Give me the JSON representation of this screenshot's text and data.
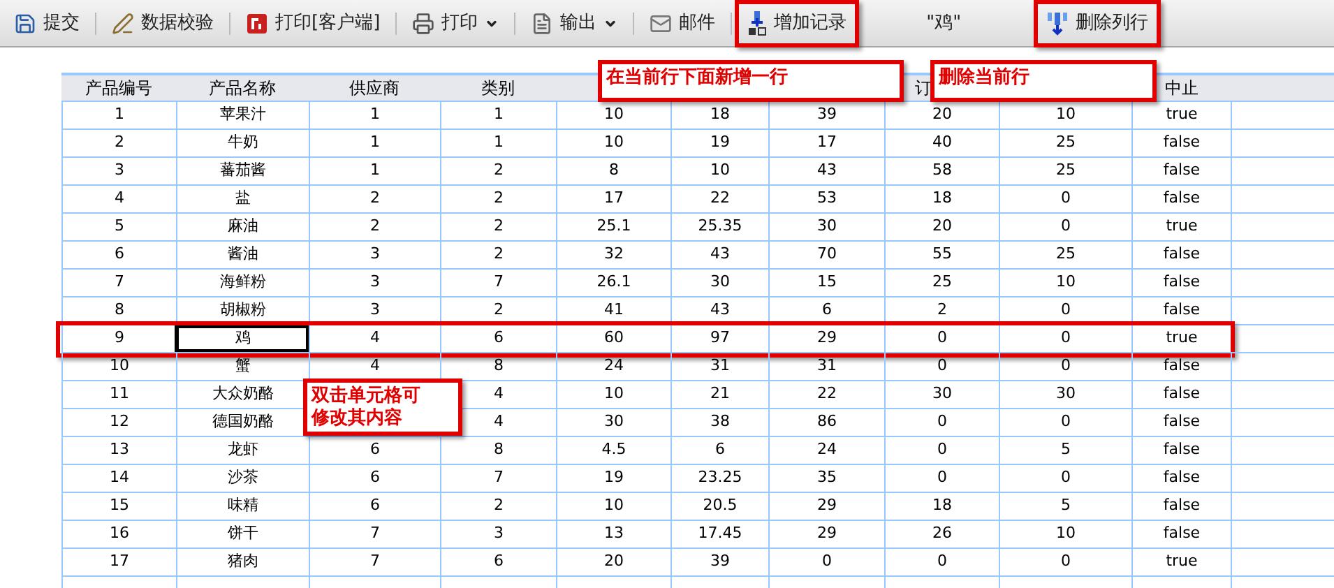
{
  "toolbar": [
    {
      "kind": "button",
      "label": "提交",
      "highlighted": false
    },
    {
      "kind": "button",
      "label": "数据校验",
      "highlighted": false
    },
    {
      "kind": "button",
      "label": "打印[客户端]",
      "highlighted": false
    },
    {
      "kind": "dropdown",
      "label": "打印",
      "highlighted": false
    },
    {
      "kind": "dropdown",
      "label": "输出",
      "highlighted": false
    },
    {
      "kind": "button",
      "label": "邮件",
      "highlighted": false
    },
    {
      "kind": "button",
      "label": "增加记录",
      "highlighted": true
    },
    {
      "kind": "label",
      "label": "\"鸡\""
    },
    {
      "kind": "button",
      "label": "删除列行",
      "highlighted": true
    }
  ],
  "table": {
    "columns": [
      "产品编号",
      "产品名称",
      "供应商",
      "类别",
      "",
      "",
      "",
      "订",
      "",
      "中止"
    ],
    "rows": [
      {
        "cells": [
          "1",
          "苹果汁",
          "1",
          "1",
          "10",
          "18",
          "39",
          "20",
          "10",
          "true"
        ],
        "selected": false,
        "highlighted": false
      },
      {
        "cells": [
          "2",
          "牛奶",
          "1",
          "1",
          "10",
          "19",
          "17",
          "40",
          "25",
          "false"
        ],
        "selected": false,
        "highlighted": false
      },
      {
        "cells": [
          "3",
          "蕃茄酱",
          "1",
          "2",
          "8",
          "10",
          "43",
          "58",
          "25",
          "false"
        ],
        "selected": false,
        "highlighted": false
      },
      {
        "cells": [
          "4",
          "盐",
          "2",
          "2",
          "17",
          "22",
          "53",
          "18",
          "0",
          "false"
        ],
        "selected": false,
        "highlighted": false
      },
      {
        "cells": [
          "5",
          "麻油",
          "2",
          "2",
          "25.1",
          "25.35",
          "30",
          "20",
          "0",
          "true"
        ],
        "selected": false,
        "highlighted": false
      },
      {
        "cells": [
          "6",
          "酱油",
          "3",
          "2",
          "32",
          "43",
          "70",
          "55",
          "25",
          "false"
        ],
        "selected": false,
        "highlighted": false
      },
      {
        "cells": [
          "7",
          "海鲜粉",
          "3",
          "7",
          "26.1",
          "30",
          "15",
          "25",
          "10",
          "false"
        ],
        "selected": false,
        "highlighted": false
      },
      {
        "cells": [
          "8",
          "胡椒粉",
          "3",
          "2",
          "41",
          "43",
          "6",
          "2",
          "0",
          "false"
        ],
        "selected": false,
        "highlighted": false
      },
      {
        "cells": [
          "9",
          "鸡",
          "4",
          "6",
          "60",
          "97",
          "29",
          "0",
          "0",
          "true"
        ],
        "selected": true,
        "highlighted": true
      },
      {
        "cells": [
          "10",
          "蟹",
          "4",
          "8",
          "24",
          "31",
          "31",
          "0",
          "0",
          "false"
        ],
        "selected": false,
        "highlighted": false
      },
      {
        "cells": [
          "11",
          "大众奶酪",
          "",
          "4",
          "10",
          "21",
          "22",
          "30",
          "30",
          "false"
        ],
        "selected": false,
        "highlighted": false
      },
      {
        "cells": [
          "12",
          "德国奶酪",
          "",
          "4",
          "30",
          "38",
          "86",
          "0",
          "0",
          "false"
        ],
        "selected": false,
        "highlighted": false
      },
      {
        "cells": [
          "13",
          "龙虾",
          "6",
          "8",
          "4.5",
          "6",
          "24",
          "0",
          "5",
          "false"
        ],
        "selected": false,
        "highlighted": false
      },
      {
        "cells": [
          "14",
          "沙茶",
          "6",
          "7",
          "19",
          "23.25",
          "35",
          "0",
          "0",
          "false"
        ],
        "selected": false,
        "highlighted": false
      },
      {
        "cells": [
          "15",
          "味精",
          "6",
          "2",
          "10",
          "20.5",
          "29",
          "18",
          "5",
          "false"
        ],
        "selected": false,
        "highlighted": false
      },
      {
        "cells": [
          "16",
          "饼干",
          "7",
          "3",
          "13",
          "17.45",
          "29",
          "26",
          "10",
          "false"
        ],
        "selected": false,
        "highlighted": false
      },
      {
        "cells": [
          "17",
          "猪肉",
          "7",
          "6",
          "20",
          "39",
          "0",
          "0",
          "0",
          "true"
        ],
        "selected": false,
        "highlighted": false
      }
    ]
  },
  "callouts": [
    {
      "kind": "add",
      "text": "在当前行下面新增一行"
    },
    {
      "kind": "delete",
      "text": "删除当前行"
    },
    {
      "kind": "edit",
      "text": "双击单元格可修改其内容"
    }
  ]
}
